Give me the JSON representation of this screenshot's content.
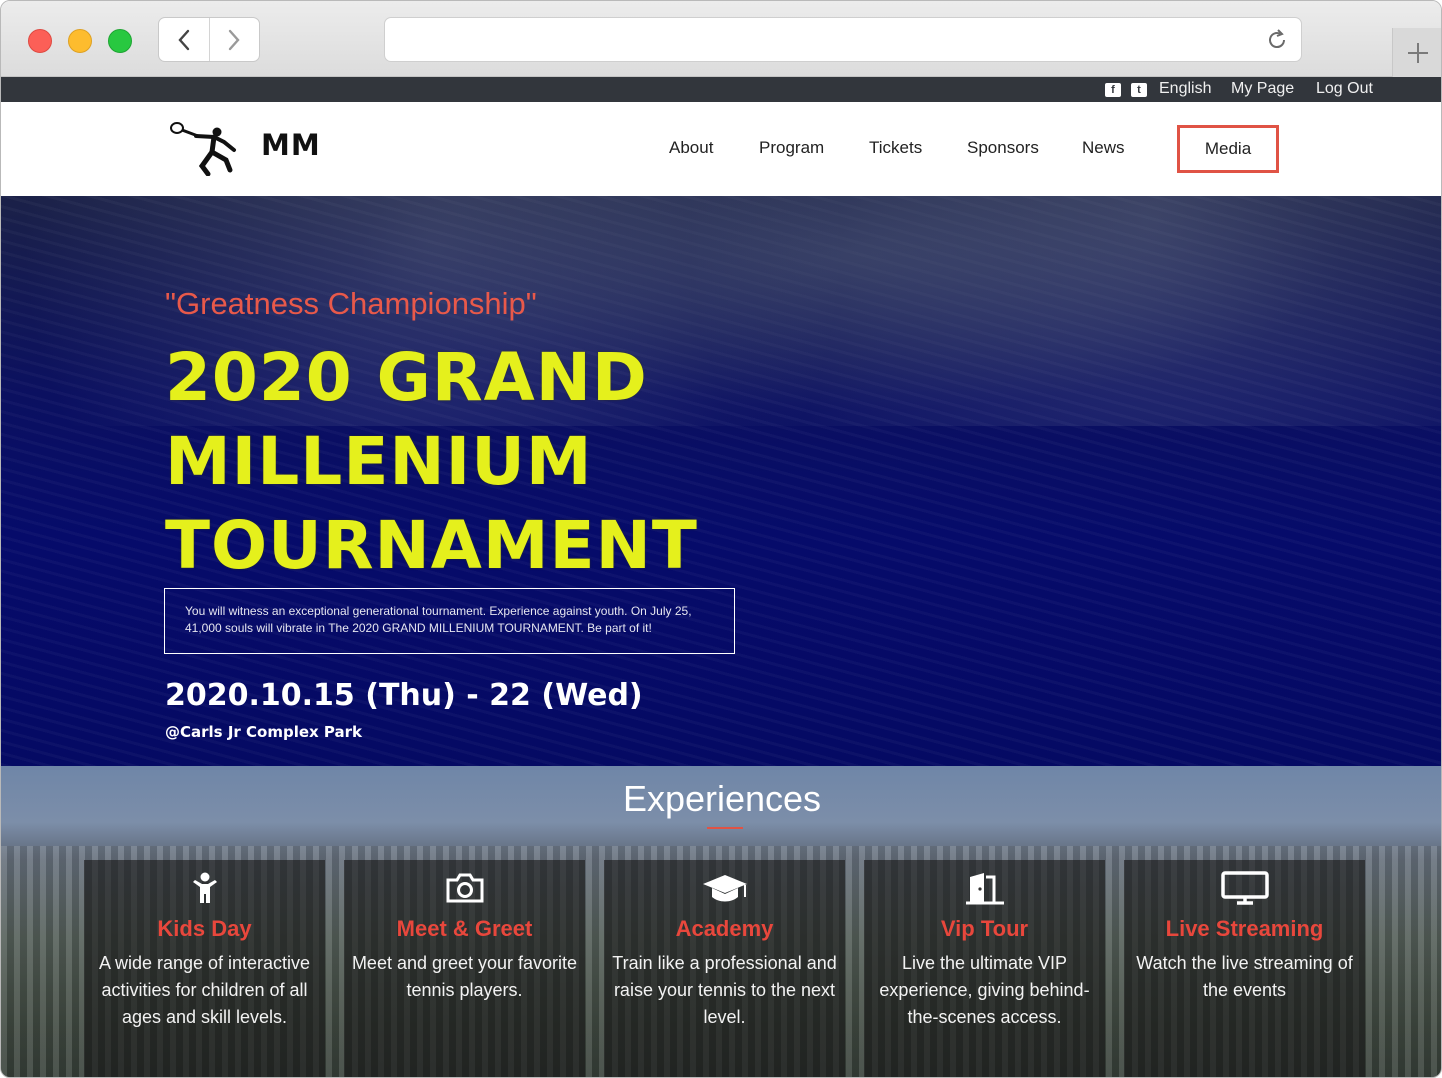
{
  "topbar": {
    "language": "English",
    "my_page": "My Page",
    "log_out": "Log Out",
    "social_icons": [
      "facebook-icon",
      "twitter-icon"
    ]
  },
  "header": {
    "logo_text": "MM",
    "nav": {
      "about": "About",
      "program": "Program",
      "tickets": "Tickets",
      "sponsors": "Sponsors",
      "news": "News",
      "media": "Media"
    },
    "active_outline_color": "#e05345"
  },
  "hero": {
    "tagline": "\"Greatness Championship\"",
    "title_line1": "2020 GRAND",
    "title_line2": "MILLENIUM",
    "title_line3": "TOURNAMENT",
    "description": "You will witness an exceptional generational tournament. Experience against youth. On July 25, 41,000 souls will vibrate in The 2020 GRAND MILLENIUM TOURNAMENT. Be part of it!",
    "dates": "2020.10.15 (Thu) - 22 (Wed)",
    "venue": "@Carls Jr Complex Park",
    "title_color": "#e5f01c",
    "tagline_color": "#e8594a"
  },
  "experiences": {
    "heading": "Experiences",
    "cards": [
      {
        "title": "Kids Day",
        "desc": "A wide range of interactive activities for children of all ages and skill levels.",
        "icon": "child-icon"
      },
      {
        "title": "Meet & Greet",
        "desc": "Meet and greet your favorite tennis players.",
        "icon": "camera-icon"
      },
      {
        "title": "Academy",
        "desc": "Train like a professional and raise your tennis to the next level.",
        "icon": "graduation-cap-icon"
      },
      {
        "title": "Vip Tour",
        "desc": "Live the ultimate VIP experience, giving behind-the-scenes access.",
        "icon": "door-icon"
      },
      {
        "title": "Live Streaming",
        "desc": "Watch the live streaming of the events",
        "icon": "monitor-icon"
      }
    ],
    "accent_color": "#e8473c"
  }
}
